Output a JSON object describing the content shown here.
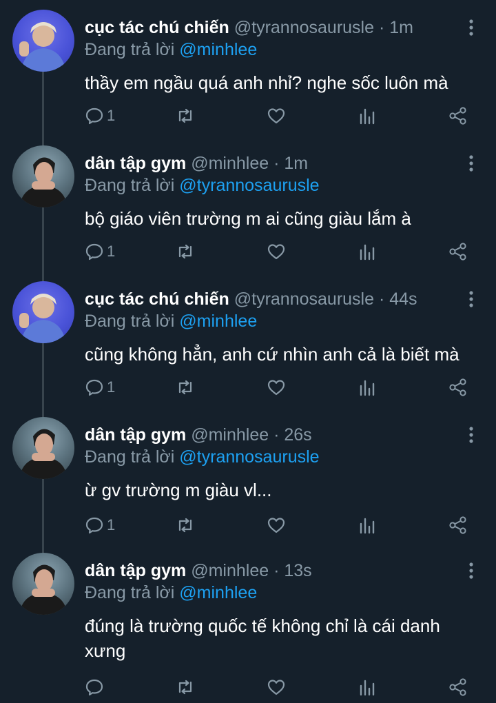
{
  "colors": {
    "background": "#15202b",
    "secondary_text": "#8899a6",
    "accent": "#1da1f2",
    "thread_line": "#38444d"
  },
  "reply_prefix": "Đang trả lời",
  "icons": {
    "more": "more-vertical-icon",
    "reply": "reply-icon",
    "retweet": "retweet-icon",
    "like": "heart-icon",
    "analytics": "analytics-icon",
    "share": "share-icon"
  },
  "tweets": [
    {
      "name": "cục tác chú chiến",
      "handle": "@tyrannosaurusle",
      "time": "1m",
      "reply_to": "@minhlee",
      "text": "thầy em ngầu quá anh nhỉ? nghe sốc luôn mà",
      "reply_count": "1"
    },
    {
      "name": "dân tập gym",
      "handle": "@minhlee",
      "time": "1m",
      "reply_to": "@tyrannosaurusle",
      "text": "bộ giáo viên trường m ai cũng giàu lắm à",
      "reply_count": "1"
    },
    {
      "name": "cục tác chú chiến",
      "handle": "@tyrannosaurusle",
      "time": "44s",
      "reply_to": "@minhlee",
      "text": "cũng không hẳn, anh cứ nhìn anh cả là biết mà",
      "reply_count": "1"
    },
    {
      "name": "dân tập gym",
      "handle": "@minhlee",
      "time": "26s",
      "reply_to": "@tyrannosaurusle",
      "text": "ừ gv trường m giàu vl...",
      "reply_count": "1"
    },
    {
      "name": "dân tập gym",
      "handle": "@minhlee",
      "time": "13s",
      "reply_to": "@minhlee",
      "text": "đúng là trường quốc tế không chỉ là cái danh xưng",
      "reply_count": ""
    }
  ]
}
